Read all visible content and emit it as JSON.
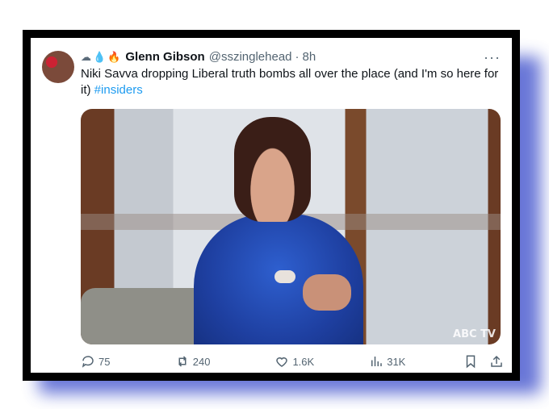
{
  "tweet": {
    "emojis": [
      "cloud-hat-icon",
      "droplet-icon",
      "fire-icon"
    ],
    "display_name": "Glenn Gibson",
    "handle": "@sszinglehead",
    "separator": "·",
    "time": "8h",
    "more_label": "···",
    "text_main": "Niki Savva dropping Liberal truth bombs all over the place (and I'm so here for it)",
    "hashtag": "#insiders",
    "media_logo": "ABC TV"
  },
  "actions": {
    "replies": "75",
    "retweets": "240",
    "likes": "1.6K",
    "views": "31K"
  },
  "colors": {
    "hashtag": "#1d9bf0",
    "frame": "#000000",
    "glow": "#4f5fd0",
    "text": "#0f1419",
    "muted": "#536471"
  }
}
